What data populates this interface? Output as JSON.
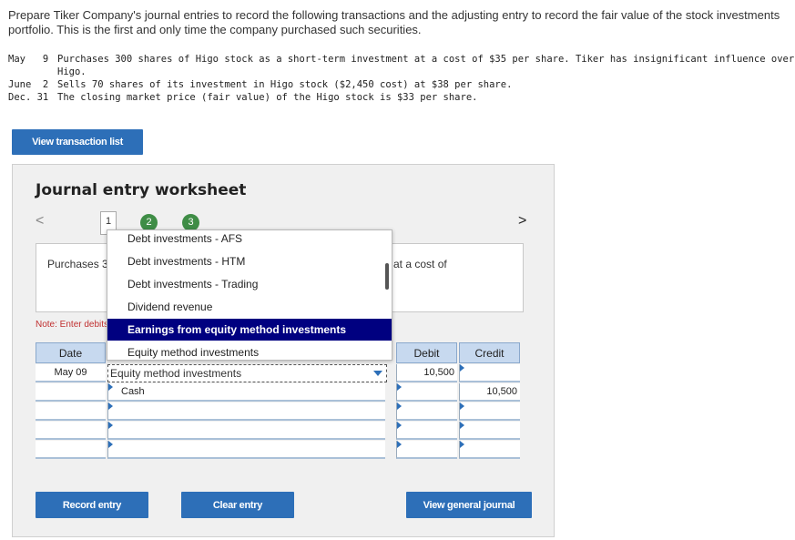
{
  "prompt": "Prepare Tiker Company's journal entries to record the following transactions and the adjusting entry to record the fair value of the stock investments portfolio. This is the first and only time the company purchased such securities.",
  "transactions": [
    {
      "date": "May   9",
      "text": "Purchases 300 shares of Higo stock as a short-term investment at a cost of $35 per share. Tiker has insignificant influence over Higo."
    },
    {
      "date": "June  2",
      "text": "Sells 70 shares of its investment in Higo stock ($2,450 cost) at $38 per share."
    },
    {
      "date": "Dec. 31",
      "text": "The closing market price (fair value) of the Higo stock is $33 per share."
    }
  ],
  "buttons": {
    "view_transaction_list": "View transaction list",
    "record_entry": "Record entry",
    "clear_entry": "Clear entry",
    "view_general_journal": "View general journal"
  },
  "worksheet": {
    "title": "Journal entry worksheet",
    "nav_prev": "<",
    "nav_next": ">",
    "tabs": [
      "1",
      "2",
      "3"
    ],
    "description_left": "Purchases 300 shares of Higo stock as a short-term investment at a cost of $35 per share.",
    "description_right": "at a cost of",
    "note": "Note: Enter debits before credits."
  },
  "table": {
    "headers": {
      "date": "Date",
      "debit": "Debit",
      "credit": "Credit"
    },
    "rows": [
      {
        "date": "May 09",
        "account": "Equity method investments",
        "debit": "10,500",
        "credit": ""
      },
      {
        "date": "",
        "account": "Cash",
        "debit": "",
        "credit": "10,500"
      },
      {
        "date": "",
        "account": "",
        "debit": "",
        "credit": ""
      },
      {
        "date": "",
        "account": "",
        "debit": "",
        "credit": ""
      },
      {
        "date": "",
        "account": "",
        "debit": "",
        "credit": ""
      }
    ]
  },
  "dropdown": {
    "options": [
      "Debt investments - AFS",
      "Debt investments - HTM",
      "Debt investments - Trading",
      "Dividend revenue",
      "Earnings from equity method investments",
      "Equity method investments"
    ],
    "highlighted": "Earnings from equity method investments"
  },
  "colors": {
    "button_blue": "#2d6fb8",
    "tab_green": "#3f8d46",
    "highlight_navy": "#000080",
    "note_red": "#c03030",
    "header_blue": "#c7d9ef"
  }
}
